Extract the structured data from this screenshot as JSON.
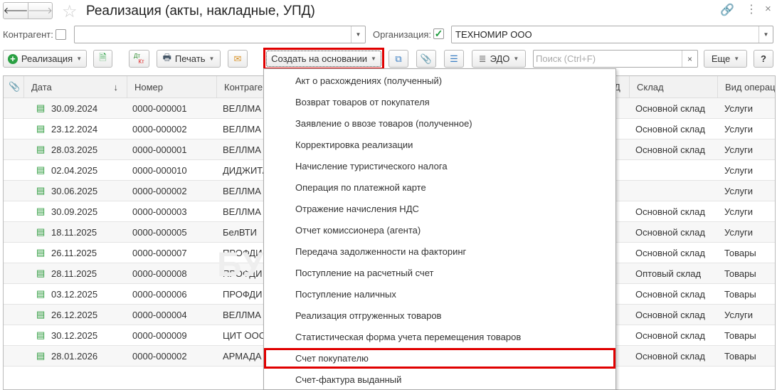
{
  "title": "Реализация (акты, накладные, УПД)",
  "filters": {
    "counterparty_label": "Контрагент:",
    "counterparty_value": "",
    "organization_label": "Организация:",
    "organization_value": "ТЕХНОМИР ООО"
  },
  "toolbar": {
    "create": "Реализация",
    "dtkt_top": "Дт",
    "dtkt_bottom": "Кт",
    "print": "Печать",
    "create_based": "Создать на основании",
    "edo": "ЭДО",
    "search_placeholder": "Поиск (Ctrl+F)",
    "clear": "×",
    "more": "Еще",
    "help": "?"
  },
  "columns": {
    "date": "Дата",
    "sort": "↓",
    "number": "Номер",
    "counterparty": "Контраген",
    "hidden": "Д",
    "warehouse": "Склад",
    "operation": "Вид операц"
  },
  "rows": [
    {
      "date": "30.09.2024",
      "number": "0000-000001",
      "counterparty": "ВЕЛЛМА",
      "warehouse": "Основной склад",
      "operation": "Услуги"
    },
    {
      "date": "23.12.2024",
      "number": "0000-000002",
      "counterparty": "ВЕЛЛМА",
      "warehouse": "Основной склад",
      "operation": "Услуги"
    },
    {
      "date": "28.03.2025",
      "number": "0000-000001",
      "counterparty": "ВЕЛЛМА",
      "warehouse": "Основной склад",
      "operation": "Услуги"
    },
    {
      "date": "02.04.2025",
      "number": "0000-000010",
      "counterparty": "ДИДЖИТА",
      "warehouse": "",
      "operation": "Услуги"
    },
    {
      "date": "30.06.2025",
      "number": "0000-000002",
      "counterparty": "ВЕЛЛМА",
      "warehouse": "",
      "operation": "Услуги"
    },
    {
      "date": "30.09.2025",
      "number": "0000-000003",
      "counterparty": "ВЕЛЛМА",
      "warehouse": "Основной склад",
      "operation": "Услуги"
    },
    {
      "date": "18.11.2025",
      "number": "0000-000005",
      "counterparty": "БелВТИ",
      "warehouse": "Основной склад",
      "operation": "Услуги"
    },
    {
      "date": "26.11.2025",
      "number": "0000-000007",
      "counterparty": "ПРОФДИ",
      "warehouse": "Основной склад",
      "operation": "Товары"
    },
    {
      "date": "28.11.2025",
      "number": "0000-000008",
      "counterparty": "ПРОФДИ",
      "warehouse": "Оптовый склад",
      "operation": "Товары"
    },
    {
      "date": "03.12.2025",
      "number": "0000-000006",
      "counterparty": "ПРОФДИ",
      "warehouse": "Основной склад",
      "operation": "Товары"
    },
    {
      "date": "26.12.2025",
      "number": "0000-000004",
      "counterparty": "ВЕЛЛМА",
      "warehouse": "Основной склад",
      "operation": "Услуги"
    },
    {
      "date": "30.12.2025",
      "number": "0000-000009",
      "counterparty": "ЦИТ ООС",
      "warehouse": "Основной склад",
      "operation": "Товары"
    },
    {
      "date": "28.01.2026",
      "number": "0000-000002",
      "counterparty": "АРМАДА",
      "warehouse": "Основной склад",
      "operation": "Товары"
    }
  ],
  "menu": [
    "Акт о расхождениях (полученный)",
    "Возврат товаров от покупателя",
    "Заявление о ввозе товаров (полученное)",
    "Корректировка реализации",
    "Начисление туристического налога",
    "Операция по платежной карте",
    "Отражение начисления НДС",
    "Отчет комиссионера (агента)",
    "Передача задолженности на факторинг",
    "Поступление на расчетный счет",
    "Поступление наличных",
    "Реализация отгруженных товаров",
    "Статистическая форма учета перемещения товаров",
    "Счет покупателю",
    "Счет-фактура выданный"
  ],
  "watermark": "БУХЭКСПЕРТ",
  "colors": {
    "highlight": "#e00000",
    "check": "#1a9a3a"
  }
}
